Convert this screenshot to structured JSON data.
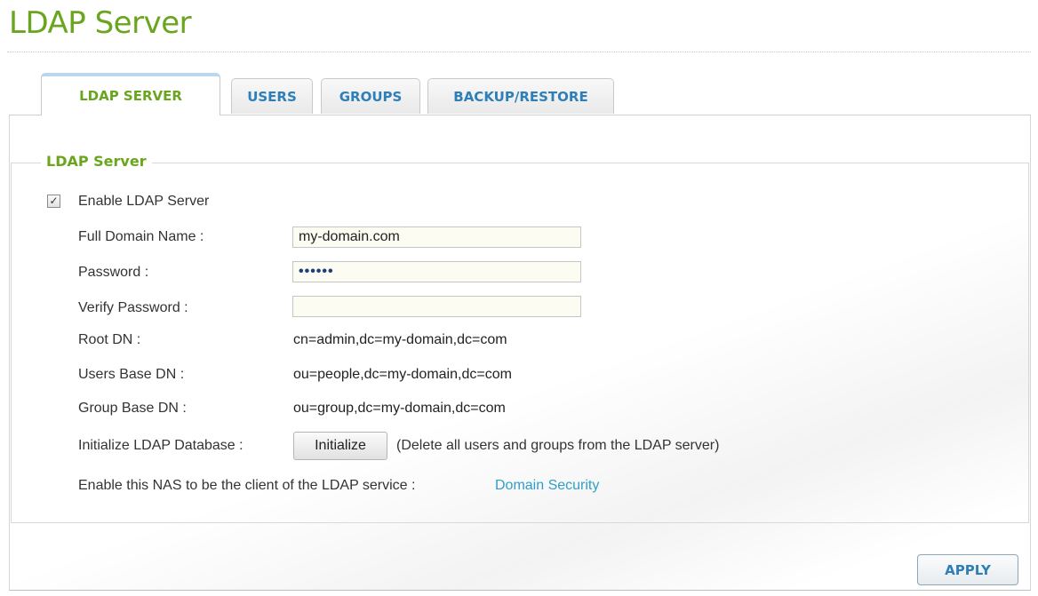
{
  "page": {
    "title": "LDAP Server"
  },
  "tabs": [
    {
      "label": "LDAP SERVER",
      "active": true
    },
    {
      "label": "USERS",
      "active": false
    },
    {
      "label": "GROUPS",
      "active": false
    },
    {
      "label": "BACKUP/RESTORE",
      "active": false
    }
  ],
  "section": {
    "legend": "LDAP Server"
  },
  "enable": {
    "label": "Enable LDAP Server",
    "checked": true,
    "check_glyph": "✓"
  },
  "fields": {
    "full_domain_name": {
      "label": "Full Domain Name :",
      "value": "my-domain.com"
    },
    "password": {
      "label": "Password :",
      "value": "••••••"
    },
    "verify_password": {
      "label": "Verify Password :",
      "value": ""
    },
    "root_dn": {
      "label": "Root DN :",
      "value": "cn=admin,dc=my-domain,dc=com"
    },
    "users_base_dn": {
      "label": "Users Base DN :",
      "value": "ou=people,dc=my-domain,dc=com"
    },
    "group_base_dn": {
      "label": "Group Base DN :",
      "value": "ou=group,dc=my-domain,dc=com"
    }
  },
  "initialize": {
    "label": "Initialize LDAP Database :",
    "button": "Initialize",
    "note": "(Delete all users and groups from the LDAP server)"
  },
  "client": {
    "text": "Enable this NAS to be the client of the LDAP service :",
    "link": "Domain Security"
  },
  "actions": {
    "apply": "APPLY"
  },
  "colors": {
    "accent_green": "#6aa51e",
    "tab_blue": "#2e7fb8",
    "link_blue": "#2f9fc8"
  }
}
